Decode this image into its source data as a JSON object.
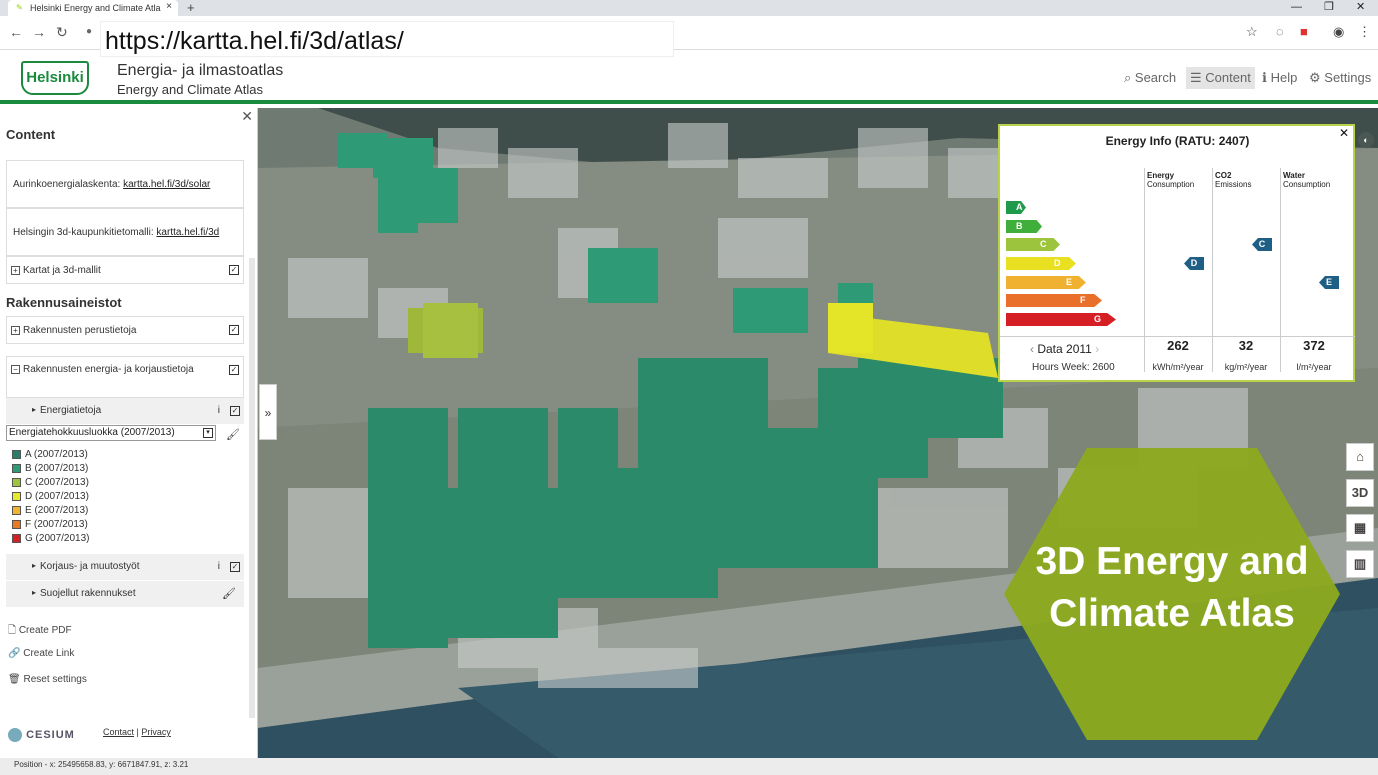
{
  "browser": {
    "tab_title": "Helsinki Energy and Climate Atla",
    "url": "https://kartta.hel.fi/3d/atlas/"
  },
  "header": {
    "logo_text": "Helsinki",
    "title_fi": "Energia- ja ilmastoatlas",
    "title_en": "Energy and Climate Atlas",
    "nav": [
      {
        "label": "Search",
        "icon": "search-icon"
      },
      {
        "label": "Content",
        "icon": "menu-icon"
      },
      {
        "label": "Help",
        "icon": "info-icon"
      },
      {
        "label": "Settings",
        "icon": "gear-icon"
      }
    ]
  },
  "panel": {
    "heading": "Content",
    "links": [
      {
        "label": "Aurinkoenergialaskenta: ",
        "link": "kartta.hel.fi/3d/solar"
      },
      {
        "label": "Helsingin 3d-kaupunkitietomalli: ",
        "link": "kartta.hel.fi/3d"
      }
    ],
    "maps_row": "Kartat ja 3d-mallit",
    "section_heading": "Rakennusaineistot",
    "rows": [
      "Rakennusten perustietoja",
      "Rakennusten energia- ja korjaustietoja"
    ],
    "sub_energy": "Energiatietoja",
    "select_value": "Energiatehokkuusluokka (2007/2013)",
    "legend": [
      {
        "label": "A (2007/2013)",
        "color": "#2a7d6a"
      },
      {
        "label": "B (2007/2013)",
        "color": "#2e9a76"
      },
      {
        "label": "C (2007/2013)",
        "color": "#9cc43c"
      },
      {
        "label": "D (2007/2013)",
        "color": "#e8e82e"
      },
      {
        "label": "E (2007/2013)",
        "color": "#f0b430"
      },
      {
        "label": "F (2007/2013)",
        "color": "#e87a22"
      },
      {
        "label": "G (2007/2013)",
        "color": "#d42020"
      }
    ],
    "sub_repair": "Korjaus- ja muutostyöt",
    "sub_protected": "Suojellut rakennukset",
    "actions": [
      "Create PDF",
      "Create Link",
      "Reset settings"
    ]
  },
  "footer": {
    "cesium": "CESIUM",
    "contact": "Contact",
    "privacy": "Privacy",
    "position": "Position - x: 25495658.83, y: 6671847.91, z: 3.21"
  },
  "energy_info": {
    "title": "Energy Info (RATU: 2407)",
    "columns": [
      {
        "line1": "Energy",
        "line2": "Consumption"
      },
      {
        "line1": "CO2",
        "line2": "Emissions"
      },
      {
        "line1": "Water",
        "line2": "Consumption"
      }
    ],
    "classes": [
      {
        "label": "A",
        "color": "#1f9a4a"
      },
      {
        "label": "B",
        "color": "#3fae3a"
      },
      {
        "label": "C",
        "color": "#9cc43c"
      },
      {
        "label": "D",
        "color": "#e8e020"
      },
      {
        "label": "E",
        "color": "#f0b030"
      },
      {
        "label": "F",
        "color": "#e8702a"
      },
      {
        "label": "G",
        "color": "#d61f25"
      }
    ],
    "markers": {
      "energy": "D",
      "co2": "C",
      "water": "E"
    },
    "data_label": "Data 2011",
    "hours": "Hours Week: 2600",
    "values": [
      {
        "value": "262",
        "unit": "kWh/m²/year"
      },
      {
        "value": "32",
        "unit": "kg/m²/year"
      },
      {
        "value": "372",
        "unit": "l/m²/year"
      }
    ]
  },
  "map_controls": [
    "home-icon",
    "3D",
    "grid-icon",
    "map-icon"
  ],
  "map_controls_3d": "3D",
  "overlay_title": "3D Energy and Climate Atlas"
}
